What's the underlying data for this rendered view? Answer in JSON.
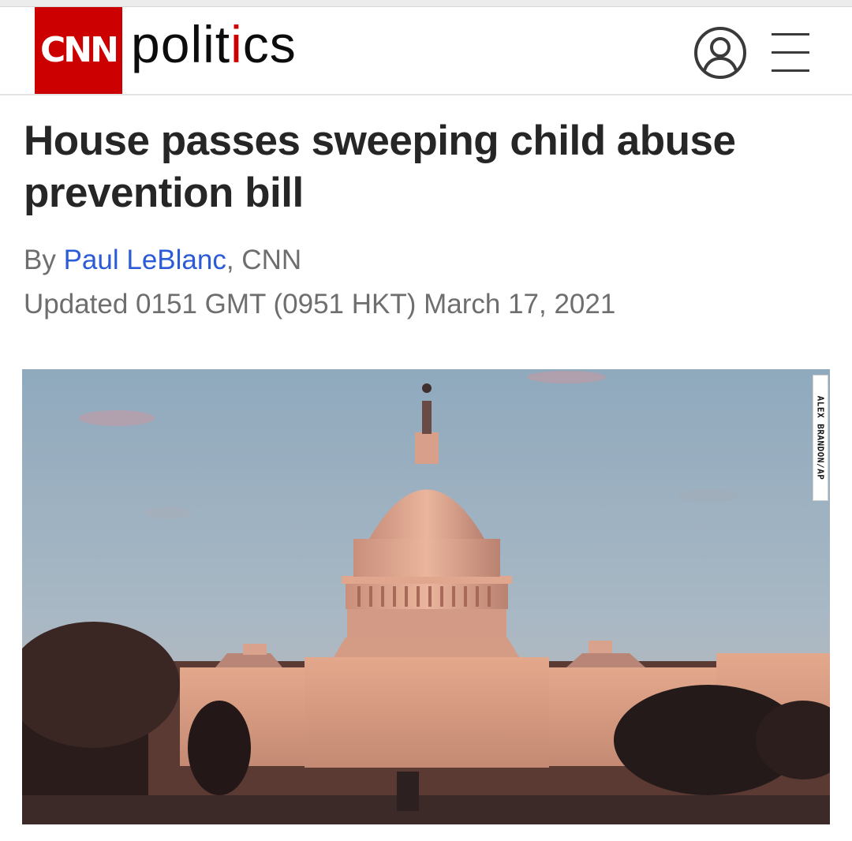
{
  "header": {
    "logo_text": "CNN",
    "section_name": "politics",
    "account_icon": "user-circle-icon",
    "menu_icon": "hamburger-menu-icon"
  },
  "article": {
    "headline": "House passes sweeping child abuse prevention bill",
    "byline_prefix": "By ",
    "author": "Paul LeBlanc",
    "byline_suffix": ", CNN",
    "updated": "Updated 0151 GMT (0951 HKT) March 17, 2021"
  },
  "hero_image": {
    "credit": "ALEX BRANDON/AP"
  },
  "colors": {
    "brand_red": "#cc0000",
    "link_blue": "#2b5bd7",
    "headline_text": "#262626",
    "meta_text": "#6e6e6e"
  }
}
